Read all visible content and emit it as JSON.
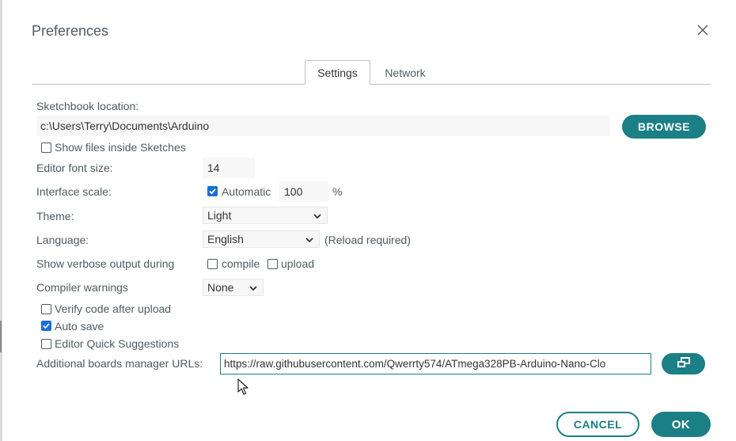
{
  "dialog": {
    "title": "Preferences",
    "close_icon": "close-icon"
  },
  "tabs": [
    {
      "label": "Settings",
      "active": true
    },
    {
      "label": "Network",
      "active": false
    }
  ],
  "sketchbook": {
    "label": "Sketchbook location:",
    "value": "c:\\Users\\Terry\\Documents\\Arduino",
    "browse_label": "BROWSE",
    "show_files_label": "Show files inside Sketches",
    "show_files_checked": false
  },
  "editor_font": {
    "label": "Editor font size:",
    "value": "14"
  },
  "interface_scale": {
    "label": "Interface scale:",
    "automatic_label": "Automatic",
    "automatic_checked": true,
    "value": "100",
    "unit": "%"
  },
  "theme": {
    "label": "Theme:",
    "value": "Light"
  },
  "language": {
    "label": "Language:",
    "value": "English",
    "note": "(Reload required)"
  },
  "verbose": {
    "label": "Show verbose output during",
    "compile_label": "compile",
    "compile_checked": false,
    "upload_label": "upload",
    "upload_checked": false
  },
  "compiler_warnings": {
    "label": "Compiler warnings",
    "value": "None"
  },
  "options": [
    {
      "label": "Verify code after upload",
      "checked": false
    },
    {
      "label": "Auto save",
      "checked": true
    },
    {
      "label": "Editor Quick Suggestions",
      "checked": false
    }
  ],
  "boards_urls": {
    "label": "Additional boards manager URLs:",
    "value": "https://raw.githubusercontent.com/Qwerrty574/ATmega328PB-Arduino-Nano-Clo",
    "edit_icon": "open-window-icon"
  },
  "footer": {
    "cancel_label": "CANCEL",
    "ok_label": "OK"
  },
  "colors": {
    "accent": "#1b7f86",
    "checkbox": "#1a6fd6",
    "text": "#4e5b61"
  }
}
